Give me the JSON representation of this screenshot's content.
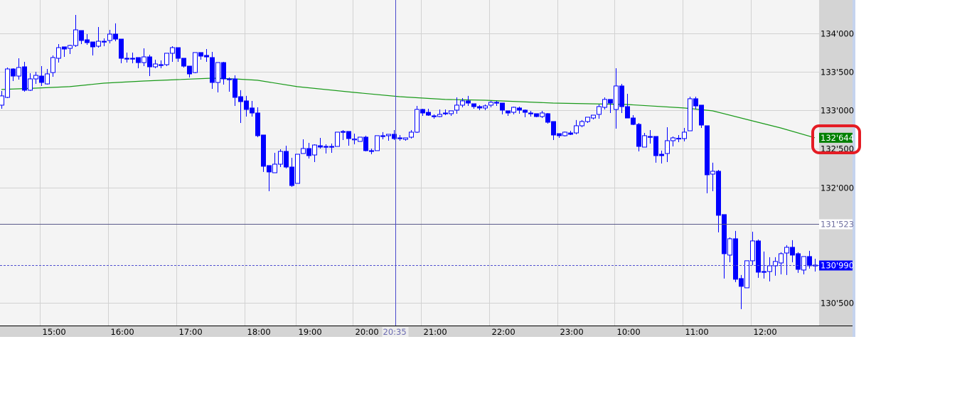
{
  "chart_data": {
    "type": "candlestick",
    "title": "",
    "xlabel": "",
    "ylabel": "",
    "ylim": [
      130300,
      134430
    ],
    "grid": true,
    "y_ticks": [
      {
        "value": 134000,
        "label": "134'000"
      },
      {
        "value": 133500,
        "label": "133'500"
      },
      {
        "value": 133000,
        "label": "133'000"
      },
      {
        "value": 132500,
        "label": "132'500"
      },
      {
        "value": 132000,
        "label": "132'000"
      },
      {
        "value": 130500,
        "label": "130'500"
      }
    ],
    "x_ticks": [
      {
        "index": 7,
        "label": "15:00"
      },
      {
        "index": 19,
        "label": "16:00"
      },
      {
        "index": 31,
        "label": "17:00"
      },
      {
        "index": 43,
        "label": "18:00"
      },
      {
        "index": 52,
        "label": "19:00"
      },
      {
        "index": 62,
        "label": "20:00"
      },
      {
        "index": 74,
        "label": "21:00"
      },
      {
        "index": 86,
        "label": "22:00"
      },
      {
        "index": 98,
        "label": "23:00"
      },
      {
        "index": 108,
        "label": "10:00"
      },
      {
        "index": 120,
        "label": "11:00"
      },
      {
        "index": 132,
        "label": "12:00"
      }
    ],
    "crosshair": {
      "index": 69.25,
      "label": "20:35"
    },
    "horizontal_line": {
      "value": 131523,
      "label": "131'523"
    },
    "last_price": {
      "value": 130990,
      "label": "130'990"
    },
    "moving_average": {
      "label": "132'644",
      "value": 132644,
      "points": [
        [
          0,
          133271
        ],
        [
          6,
          133289
        ],
        [
          12,
          133308
        ],
        [
          18,
          133354
        ],
        [
          25,
          133381
        ],
        [
          31,
          133400
        ],
        [
          37,
          133418
        ],
        [
          41,
          133409
        ],
        [
          45,
          133391
        ],
        [
          52,
          133308
        ],
        [
          62,
          133234
        ],
        [
          70,
          133178
        ],
        [
          78,
          133142
        ],
        [
          85,
          133132
        ],
        [
          97,
          133095
        ],
        [
          110,
          133077
        ],
        [
          120,
          133031
        ],
        [
          125,
          132994
        ],
        [
          132,
          132864
        ],
        [
          137,
          132772
        ],
        [
          143,
          132644
        ]
      ]
    },
    "candles_ohlc": [
      [
        133068,
        133252,
        133021,
        133188
      ],
      [
        133169,
        133557,
        133160,
        133538
      ],
      [
        133538,
        133548,
        133381,
        133446
      ],
      [
        133446,
        133677,
        133400,
        133557
      ],
      [
        133566,
        133631,
        133243,
        133262
      ],
      [
        133262,
        133483,
        133252,
        133409
      ],
      [
        133409,
        133501,
        133344,
        133455
      ],
      [
        133446,
        133575,
        133317,
        133363
      ],
      [
        133344,
        133538,
        133335,
        133474
      ],
      [
        133492,
        133714,
        133437,
        133686
      ],
      [
        133677,
        133862,
        133621,
        133815
      ],
      [
        133825,
        133825,
        133695,
        133797
      ],
      [
        133806,
        133852,
        133732,
        133843
      ],
      [
        133843,
        134240,
        133825,
        134046
      ],
      [
        134037,
        134037,
        133862,
        133908
      ],
      [
        133917,
        133991,
        133852,
        133880
      ],
      [
        133889,
        133889,
        133714,
        133825
      ],
      [
        133834,
        134083,
        133815,
        133898
      ],
      [
        133898,
        133935,
        133834,
        133889
      ],
      [
        133908,
        134046,
        133871,
        133991
      ],
      [
        133991,
        134130,
        133898,
        133926
      ],
      [
        133926,
        133926,
        133612,
        133677
      ],
      [
        133677,
        133751,
        133621,
        133672
      ],
      [
        133677,
        133751,
        133612,
        133668
      ],
      [
        133686,
        133686,
        133548,
        133621
      ],
      [
        133621,
        133806,
        133575,
        133695
      ],
      [
        133695,
        133723,
        133446,
        133566
      ],
      [
        133566,
        133658,
        133548,
        133603
      ],
      [
        133594,
        133649,
        133548,
        133590
      ],
      [
        133594,
        133742,
        133575,
        133742
      ],
      [
        133742,
        133834,
        133631,
        133815
      ],
      [
        133815,
        133815,
        133631,
        133677
      ],
      [
        133677,
        133677,
        133557,
        133575
      ],
      [
        133575,
        133575,
        133428,
        133474
      ],
      [
        133492,
        133751,
        133483,
        133751
      ],
      [
        133751,
        133751,
        133658,
        133705
      ],
      [
        133714,
        133797,
        133631,
        133695
      ],
      [
        133686,
        133760,
        133280,
        133363
      ],
      [
        133363,
        133621,
        133234,
        133621
      ],
      [
        133621,
        133631,
        133335,
        133409
      ],
      [
        133409,
        133428,
        133243,
        133405
      ],
      [
        133409,
        133455,
        133058,
        133169
      ],
      [
        133178,
        133262,
        132837,
        133114
      ],
      [
        133123,
        133188,
        132920,
        133012
      ],
      [
        133031,
        133123,
        132920,
        132966
      ],
      [
        132966,
        133040,
        132652,
        132671
      ],
      [
        132680,
        132680,
        132200,
        132274
      ],
      [
        132283,
        132283,
        131950,
        132200
      ],
      [
        132190,
        132449,
        132190,
        132301
      ],
      [
        132301,
        132495,
        132264,
        132467
      ],
      [
        132467,
        132541,
        132246,
        132264
      ],
      [
        132264,
        132384,
        132006,
        132024
      ],
      [
        132052,
        132430,
        132052,
        132430
      ],
      [
        132440,
        132624,
        132440,
        132504
      ],
      [
        132504,
        132578,
        132375,
        132412
      ],
      [
        132421,
        132560,
        132329,
        132550
      ],
      [
        132541,
        132643,
        132504,
        132523
      ],
      [
        132532,
        132560,
        132440,
        132523
      ],
      [
        132532,
        132569,
        132449,
        132528
      ],
      [
        132532,
        132717,
        132532,
        132717
      ],
      [
        132726,
        132744,
        132615,
        132722
      ],
      [
        132726,
        132726,
        132541,
        132634
      ],
      [
        132624,
        132698,
        132560,
        132628
      ],
      [
        132597,
        132652,
        132597,
        132652
      ],
      [
        132652,
        132671,
        132467,
        132477
      ],
      [
        132477,
        132504,
        132430,
        132467
      ],
      [
        132477,
        132671,
        132477,
        132671
      ],
      [
        132671,
        132717,
        132624,
        132666
      ],
      [
        132671,
        132689,
        132606,
        132689
      ],
      [
        132689,
        132744,
        132615,
        132634
      ],
      [
        132643,
        132680,
        132606,
        132638
      ],
      [
        132624,
        132643,
        132606,
        132643
      ],
      [
        132652,
        132744,
        132634,
        132717
      ],
      [
        132717,
        133058,
        132707,
        133012
      ],
      [
        133012,
        133021,
        132929,
        132966
      ],
      [
        132975,
        133021,
        132929,
        132938
      ],
      [
        132929,
        132948,
        132892,
        132925
      ],
      [
        132920,
        133012,
        132911,
        132948
      ],
      [
        132966,
        133012,
        132938,
        132957
      ],
      [
        132957,
        132994,
        132929,
        132994
      ],
      [
        133003,
        133169,
        132957,
        133068
      ],
      [
        133068,
        133160,
        133040,
        133123
      ],
      [
        133123,
        133188,
        133058,
        133095
      ],
      [
        133086,
        133086,
        133021,
        133049
      ],
      [
        133049,
        133068,
        133003,
        133031
      ],
      [
        133031,
        133077,
        133003,
        133058
      ],
      [
        133068,
        133123,
        133040,
        133105
      ],
      [
        133105,
        133123,
        133058,
        133100
      ],
      [
        133095,
        133095,
        132948,
        133003
      ],
      [
        132994,
        132994,
        132929,
        132966
      ],
      [
        132975,
        133049,
        132948,
        133040
      ],
      [
        133031,
        133049,
        132957,
        133003
      ],
      [
        133003,
        133012,
        132911,
        132975
      ],
      [
        132966,
        132994,
        132920,
        132961
      ],
      [
        132957,
        132957,
        132911,
        132920
      ],
      [
        132920,
        132994,
        132901,
        132966
      ],
      [
        132957,
        132966,
        132828,
        132846
      ],
      [
        132855,
        132855,
        132615,
        132680
      ],
      [
        132698,
        132698,
        132643,
        132671
      ],
      [
        132671,
        132726,
        132661,
        132717
      ],
      [
        132707,
        132735,
        132680,
        132689
      ],
      [
        132707,
        132874,
        132689,
        132800
      ],
      [
        132800,
        132874,
        132781,
        132855
      ],
      [
        132855,
        132901,
        132837,
        132911
      ],
      [
        132901,
        132929,
        132883,
        132938
      ],
      [
        132948,
        133077,
        132892,
        133049
      ],
      [
        133040,
        133169,
        133012,
        133142
      ],
      [
        133142,
        133142,
        132966,
        133095
      ],
      [
        133012,
        133548,
        132763,
        133317
      ],
      [
        133317,
        133344,
        132966,
        133049
      ],
      [
        133049,
        133215,
        132901,
        132901
      ],
      [
        132901,
        132938,
        132809,
        132818
      ],
      [
        132818,
        132837,
        132467,
        132532
      ],
      [
        132523,
        132707,
        132523,
        132671
      ],
      [
        132661,
        132744,
        132569,
        132656
      ],
      [
        132661,
        132661,
        132320,
        132412
      ],
      [
        132430,
        132477,
        132310,
        132412
      ],
      [
        132440,
        132781,
        132329,
        132606
      ],
      [
        132606,
        132661,
        132532,
        132643
      ],
      [
        132634,
        132680,
        132587,
        132638
      ],
      [
        132634,
        132772,
        132597,
        132717
      ],
      [
        132735,
        133178,
        132735,
        133151
      ],
      [
        133151,
        133178,
        133012,
        133058
      ],
      [
        133068,
        133068,
        132772,
        132809
      ],
      [
        132800,
        132800,
        131923,
        132163
      ],
      [
        132172,
        132320,
        131950,
        132209
      ],
      [
        132209,
        132227,
        131415,
        131637
      ],
      [
        131646,
        131646,
        130815,
        131138
      ],
      [
        131120,
        131350,
        131027,
        131332
      ],
      [
        131332,
        131434,
        130769,
        130806
      ],
      [
        130815,
        130861,
        130418,
        130714
      ],
      [
        130695,
        131046,
        130695,
        131046
      ],
      [
        131046,
        131424,
        130990,
        131304
      ],
      [
        131304,
        131323,
        130824,
        130898
      ],
      [
        130907,
        131166,
        130815,
        130902
      ],
      [
        130907,
        131092,
        130778,
        130981
      ],
      [
        130981,
        131092,
        130852,
        131037
      ],
      [
        131018,
        131157,
        130870,
        131138
      ],
      [
        131147,
        131249,
        130861,
        131221
      ],
      [
        131221,
        131314,
        131027,
        131120
      ],
      [
        131138,
        131157,
        130889,
        130935
      ],
      [
        130926,
        131101,
        130870,
        131101
      ],
      [
        131101,
        131175,
        130944,
        130981
      ],
      [
        130985,
        131073,
        130907,
        130990
      ]
    ],
    "colors": {
      "candle": "#0000ff",
      "moving_average": "#1a9a1a",
      "ma_label_bg": "#008000",
      "last_price_bg": "#0000ff",
      "horizontal_line": "#5a5a8a",
      "crosshair": "#4a4acc",
      "highlight_ring": "#e41c24"
    }
  }
}
